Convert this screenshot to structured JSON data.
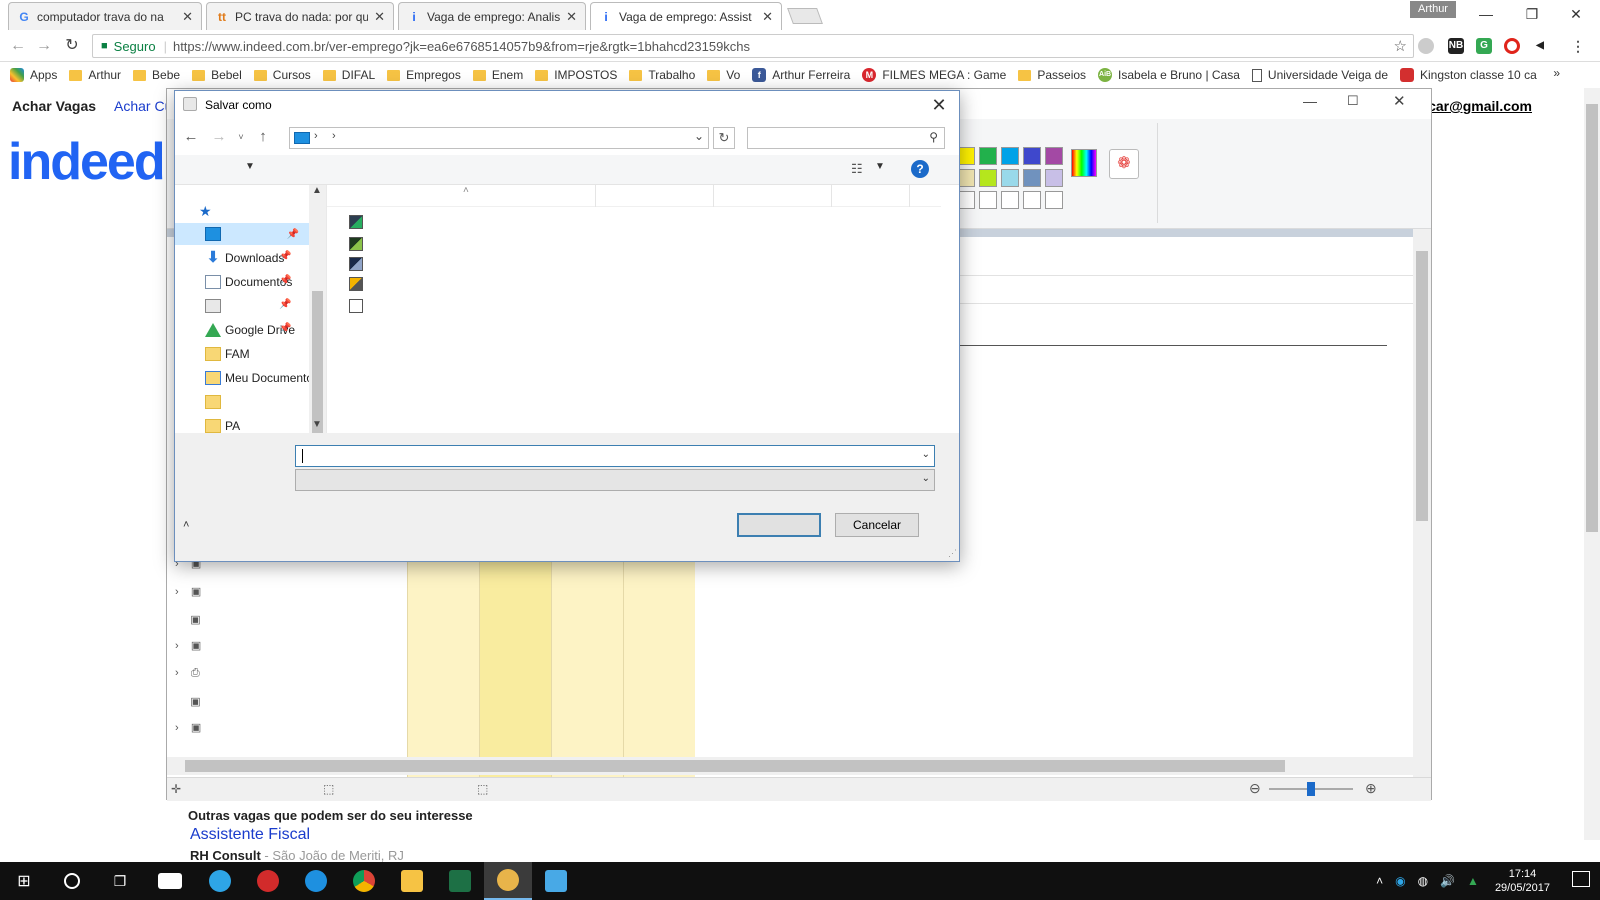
{
  "browser": {
    "tabs": [
      {
        "title": "computador trava do na",
        "favicon": "google-icon",
        "color": "#4285f4"
      },
      {
        "title": "PC trava do nada: por qu",
        "favicon": "tt-icon",
        "color": "#e07b1a"
      },
      {
        "title": "Vaga de emprego: Analis",
        "favicon": "indeed-icon",
        "color": "#2164f3"
      },
      {
        "title": "Vaga de emprego: Assist",
        "favicon": "indeed-icon",
        "color": "#2164f3"
      }
    ],
    "user": "Arthur",
    "secure_label": "Seguro",
    "url": "https://www.indeed.com.br/ver-emprego?jk=ea6e6768514057b9&from=rje&rgtk=1bhahcd23159kchs",
    "bookmarks": [
      {
        "label": "Apps",
        "icon": "apps-icon"
      },
      {
        "label": "Arthur",
        "icon": "folder-icon"
      },
      {
        "label": "Bebe",
        "icon": "folder-icon"
      },
      {
        "label": "Bebel",
        "icon": "folder-icon"
      },
      {
        "label": "Cursos",
        "icon": "folder-icon"
      },
      {
        "label": "DIFAL",
        "icon": "folder-icon"
      },
      {
        "label": "Empregos",
        "icon": "folder-icon"
      },
      {
        "label": "Enem",
        "icon": "folder-icon"
      },
      {
        "label": "IMPOSTOS",
        "icon": "folder-icon"
      },
      {
        "label": "Trabalho",
        "icon": "folder-icon"
      },
      {
        "label": "Vo",
        "icon": "folder-icon"
      },
      {
        "label": "Arthur Ferreira",
        "icon": "facebook-icon"
      },
      {
        "label": "FILMES MEGA : Game",
        "icon": "mega-icon"
      },
      {
        "label": "Passeios",
        "icon": "folder-icon"
      },
      {
        "label": "Isabela e Bruno | Casa",
        "icon": "aib-icon"
      },
      {
        "label": "Universidade Veiga de",
        "icon": "page-icon"
      },
      {
        "label": "Kingston classe 10 ca",
        "icon": "kingston-icon"
      }
    ],
    "bookmarks_more": "»"
  },
  "page": {
    "nav_find_jobs": "Achar Vagas",
    "nav_find_cv": "Achar Cu",
    "logo": "indeed",
    "email": "art.fer.car@gmail.com",
    "related_heading": "Outras vagas que podem ser do seu interesse",
    "related_job_title": "Assistente Fiscal",
    "related_company": "RH Consult",
    "related_location": " - São João de Meriti, RJ"
  },
  "dialog": {
    "title": "Salvar como",
    "close": "✕",
    "nav_items": [
      {
        "label": "Downloads",
        "icon": "download-icon",
        "pinned": true
      },
      {
        "label": "Documentos",
        "icon": "documents-icon",
        "pinned": true
      },
      {
        "label": "Google Drive",
        "icon": "google-drive-icon",
        "pinned": true
      },
      {
        "label": "FAM",
        "icon": "folder-icon",
        "pinned": false
      },
      {
        "label": "Meu Documento",
        "icon": "sync-folder-icon",
        "pinned": false
      },
      {
        "label": "PA",
        "icon": "folder-icon",
        "pinned": false
      }
    ],
    "filename_value": "",
    "filetype_value": "",
    "save_label": "",
    "cancel_label": "Cancelar"
  },
  "taskbar": {
    "time": "17:14",
    "date": "29/05/2017",
    "apps": [
      {
        "name": "start-icon",
        "color": "#ffffff"
      },
      {
        "name": "cortana-icon",
        "color": "#ffffff"
      },
      {
        "name": "task-view-icon",
        "color": "#ffffff"
      },
      {
        "name": "mail-icon",
        "color": "#ffffff"
      },
      {
        "name": "teamviewer-icon",
        "color": "#2ea5e6"
      },
      {
        "name": "antivirus-icon",
        "color": "#d22b2b"
      },
      {
        "name": "ie-icon",
        "color": "#1e90e0"
      },
      {
        "name": "chrome-icon",
        "color": "#4caf50"
      },
      {
        "name": "explorer-icon",
        "color": "#f6c344"
      },
      {
        "name": "excel-icon",
        "color": "#1d7045"
      },
      {
        "name": "paint-icon",
        "color": "#e8b44a"
      },
      {
        "name": "remote-icon",
        "color": "#48a9e6"
      }
    ]
  },
  "colors": {
    "indeed_blue": "#2164f3",
    "link_blue": "#1a3ccc",
    "selection": "#cce8ff",
    "dialog_border": "#6c8fbd"
  }
}
